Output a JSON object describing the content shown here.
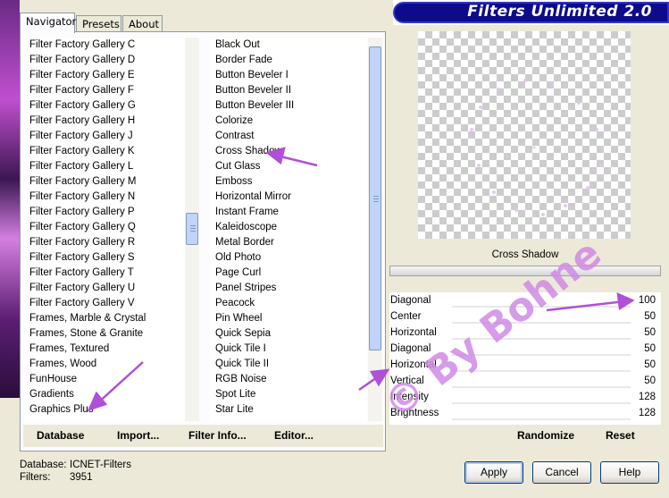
{
  "header": {
    "title": "Filters Unlimited 2.0"
  },
  "tabs": [
    {
      "label": "Navigator",
      "active": true
    },
    {
      "label": "Presets",
      "active": false
    },
    {
      "label": "About",
      "active": false
    }
  ],
  "categories": [
    "Filter Factory Gallery C",
    "Filter Factory Gallery D",
    "Filter Factory Gallery E",
    "Filter Factory Gallery F",
    "Filter Factory Gallery G",
    "Filter Factory Gallery H",
    "Filter Factory Gallery J",
    "Filter Factory Gallery K",
    "Filter Factory Gallery L",
    "Filter Factory Gallery M",
    "Filter Factory Gallery N",
    "Filter Factory Gallery P",
    "Filter Factory Gallery Q",
    "Filter Factory Gallery R",
    "Filter Factory Gallery S",
    "Filter Factory Gallery T",
    "Filter Factory Gallery U",
    "Filter Factory Gallery V",
    "Frames, Marble & Crystal",
    "Frames, Stone & Granite",
    "Frames, Textured",
    "Frames, Wood",
    "FunHouse",
    "Gradients",
    "Graphics Plus"
  ],
  "filters": [
    "Black Out",
    "Border Fade",
    "Button Beveler I",
    "Button Beveler II",
    "Button Beveler III",
    "Colorize",
    "Contrast",
    "Cross Shadow",
    "Cut Glass",
    "Emboss",
    "Horizontal Mirror",
    "Instant Frame",
    "Kaleidoscope",
    "Metal Border",
    "Old Photo",
    "Page Curl",
    "Panel Stripes",
    "Peacock",
    "Pin Wheel",
    "Quick Sepia",
    "Quick Tile I",
    "Quick Tile II",
    "RGB Noise",
    "Spot Lite",
    "Star Lite"
  ],
  "bottom_buttons": {
    "database": "Database",
    "import": "Import...",
    "filter_info": "Filter Info...",
    "editor": "Editor...",
    "randomize": "Randomize",
    "reset": "Reset"
  },
  "preview": {
    "filter_name": "Cross Shadow"
  },
  "params": [
    {
      "label": "Diagonal",
      "value": "100"
    },
    {
      "label": "Center",
      "value": "50"
    },
    {
      "label": "Horizontal",
      "value": "50"
    },
    {
      "label": "Diagonal",
      "value": "50"
    },
    {
      "label": "Horizontal",
      "value": "50"
    },
    {
      "label": "Vertical",
      "value": "50"
    },
    {
      "label": "Intensity",
      "value": "128"
    },
    {
      "label": "Brightness",
      "value": "128"
    }
  ],
  "status": {
    "database_label": "Database:",
    "database_value": "ICNET-Filters",
    "filters_label": "Filters:",
    "filters_value": "3951"
  },
  "dialog_buttons": {
    "apply": "Apply",
    "cancel": "Cancel",
    "help": "Help"
  },
  "watermark": {
    "text": "© By Bohne"
  },
  "colors": {
    "accent": "#b04fd8",
    "title_bar": "#0b0b8c"
  }
}
